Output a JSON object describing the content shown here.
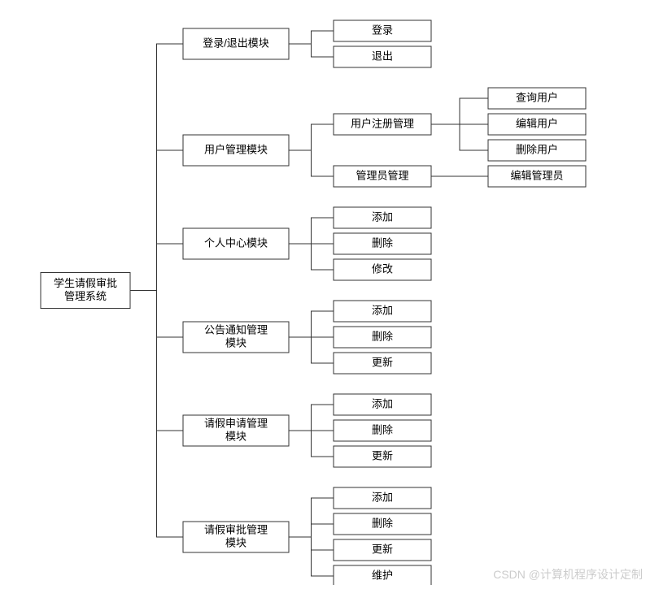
{
  "root": "学生请假审批管理系统",
  "modules": [
    {
      "name": "登录/退出模块",
      "children": [
        "登录",
        "退出"
      ]
    },
    {
      "name": "用户管理模块",
      "children": [
        {
          "name": "用户注册管理",
          "children": [
            "查询用户",
            "编辑用户",
            "删除用户"
          ]
        },
        {
          "name": "管理员管理",
          "children": [
            "编辑管理员"
          ]
        }
      ]
    },
    {
      "name": "个人中心模块",
      "children": [
        "添加",
        "删除",
        "修改"
      ]
    },
    {
      "name": "公告通知管理模块",
      "children": [
        "添加",
        "删除",
        "更新"
      ]
    },
    {
      "name": "请假申请管理模块",
      "children": [
        "添加",
        "删除",
        "更新"
      ]
    },
    {
      "name": "请假审批管理模块",
      "children": [
        "添加",
        "删除",
        "更新",
        "维护"
      ]
    }
  ],
  "watermark": "CSDN @计算机程序设计定制"
}
